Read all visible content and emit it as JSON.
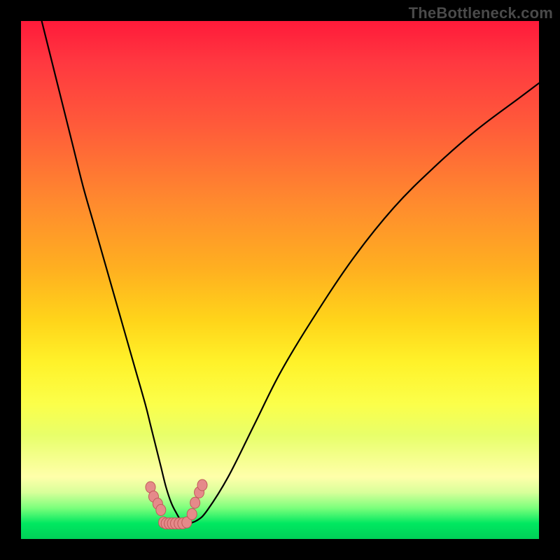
{
  "watermark": "TheBottleneck.com",
  "chart_data": {
    "type": "line",
    "title": "",
    "xlabel": "",
    "ylabel": "",
    "xlim": [
      0,
      100
    ],
    "ylim": [
      0,
      100
    ],
    "grid": false,
    "legend": false,
    "series": [
      {
        "name": "curve",
        "x": [
          4,
          6,
          8,
          10,
          12,
          14,
          16,
          18,
          20,
          22,
          24,
          25,
          26,
          27,
          28,
          29,
          30,
          31,
          32,
          34,
          36,
          40,
          45,
          50,
          56,
          64,
          72,
          80,
          88,
          96,
          100
        ],
        "y": [
          100,
          92,
          84,
          76,
          68,
          61,
          54,
          47,
          40,
          33,
          26,
          22,
          18,
          14,
          10,
          7,
          5,
          3.4,
          3,
          3.6,
          5.6,
          12,
          22,
          32,
          42,
          54,
          64,
          72,
          79,
          85,
          88
        ]
      }
    ],
    "markers": [
      {
        "x": 25.0,
        "y": 10.0
      },
      {
        "x": 25.6,
        "y": 8.2
      },
      {
        "x": 26.4,
        "y": 6.8
      },
      {
        "x": 27.0,
        "y": 5.6
      },
      {
        "x": 27.5,
        "y": 3.2
      },
      {
        "x": 28.0,
        "y": 3.0
      },
      {
        "x": 28.6,
        "y": 3.0
      },
      {
        "x": 29.2,
        "y": 3.0
      },
      {
        "x": 29.8,
        "y": 3.0
      },
      {
        "x": 30.5,
        "y": 3.0
      },
      {
        "x": 31.2,
        "y": 3.0
      },
      {
        "x": 32.0,
        "y": 3.2
      },
      {
        "x": 33.0,
        "y": 4.8
      },
      {
        "x": 33.6,
        "y": 7.0
      },
      {
        "x": 34.4,
        "y": 9.0
      },
      {
        "x": 35.0,
        "y": 10.4
      }
    ],
    "annotations": []
  }
}
